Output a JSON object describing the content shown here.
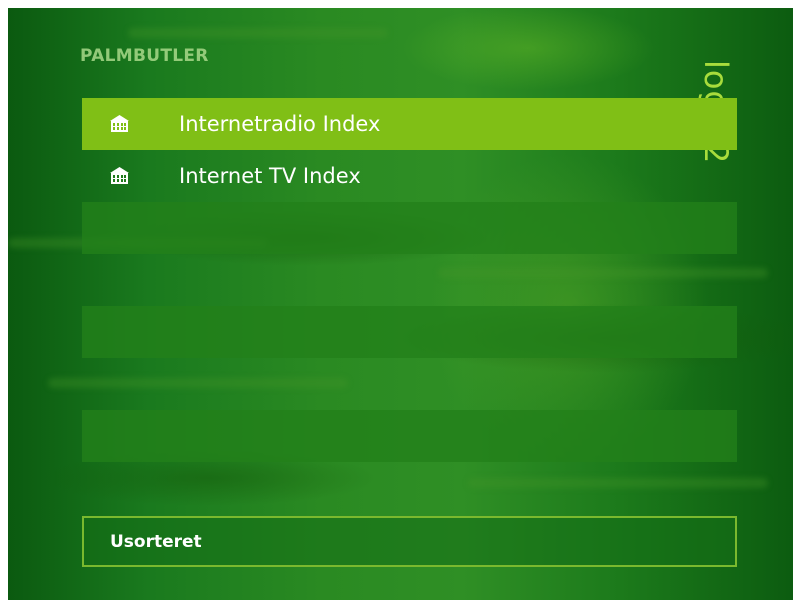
{
  "header": {
    "logo_text": "PALMBUTLER",
    "vertical_title": "login2"
  },
  "menu": {
    "items": [
      {
        "label": "Internetradio Index",
        "icon": "building-icon",
        "selected": true
      },
      {
        "label": "Internet TV Index",
        "icon": "building-icon",
        "selected": false
      },
      {
        "label": "",
        "icon": "",
        "selected": false
      },
      {
        "label": "",
        "icon": "",
        "selected": false
      },
      {
        "label": "",
        "icon": "",
        "selected": false
      },
      {
        "label": "",
        "icon": "",
        "selected": false
      },
      {
        "label": "",
        "icon": "",
        "selected": false
      },
      {
        "label": "",
        "icon": "",
        "selected": false
      }
    ]
  },
  "footer": {
    "label": "Usorteret"
  },
  "colors": {
    "background": "#1a7a1e",
    "selected_row": "#80bf16",
    "filled_row": "#22801a",
    "accent_text": "#a8dc3c",
    "text": "#ffffff"
  }
}
